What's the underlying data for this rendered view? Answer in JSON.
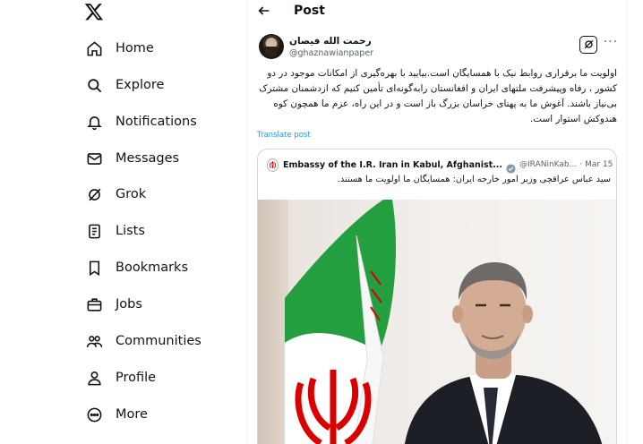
{
  "sidebar": {
    "logo": "x-logo",
    "items": [
      {
        "label": "Home",
        "icon": "home-icon"
      },
      {
        "label": "Explore",
        "icon": "search-icon"
      },
      {
        "label": "Notifications",
        "icon": "bell-icon"
      },
      {
        "label": "Messages",
        "icon": "envelope-icon"
      },
      {
        "label": "Grok",
        "icon": "grok-icon"
      },
      {
        "label": "Lists",
        "icon": "list-icon"
      },
      {
        "label": "Bookmarks",
        "icon": "bookmark-icon"
      },
      {
        "label": "Jobs",
        "icon": "briefcase-icon"
      },
      {
        "label": "Communities",
        "icon": "people-icon"
      },
      {
        "label": "Profile",
        "icon": "person-icon"
      },
      {
        "label": "More",
        "icon": "more-circle-icon"
      }
    ]
  },
  "header": {
    "title": "Post",
    "back_icon": "arrow-left-icon"
  },
  "post": {
    "author_name": "رحمت الله فیصان",
    "author_handle": "@ghaznawianpaper",
    "text": "اولویت ما برقراری روابط نیک با همسایگان است.بیایید با بهره‌گیری از امکانات موجود در دو کشور ، رفاه وپیشرفت ملتهای ایران و افغانستان رابه‌گونه‌ای تأمین کنیم که ازدشمنان مشترک بی‌نیاز باشند. آغوش ما به پهنای خراسان بزرگ  باز است و در این راه، عزم ما همچون کوه هندوکش استوار است.",
    "translate_label": "Translate post",
    "quote": {
      "name": "Embassy of the I.R. Iran in Kabul, Afghanist...",
      "handle": "@IRANinKab...",
      "separator": "·",
      "date": "Mar 15",
      "text": "سید عباس عراقچی وزیر امور خارجه ایران: همسایگان ما اولویت ما هستند."
    }
  },
  "colors": {
    "text": "#0f1419",
    "secondary": "#536471",
    "link": "#1d9bf0",
    "border": "#cfd9de",
    "flag_green": "#239f40",
    "flag_red": "#da0000"
  }
}
